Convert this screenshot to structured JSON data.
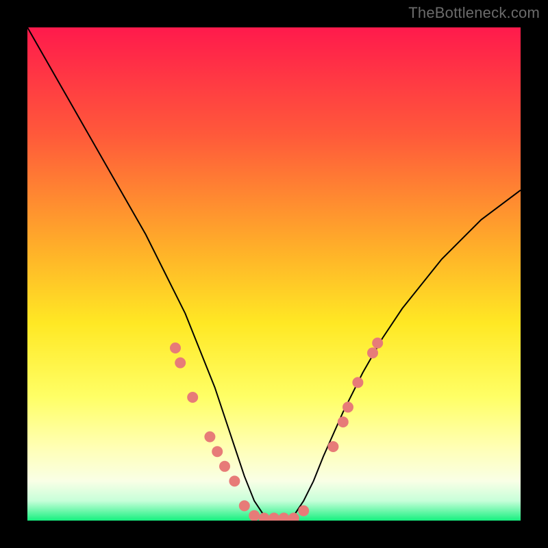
{
  "watermark": "TheBottleneck.com",
  "chart_data": {
    "type": "line",
    "title": "",
    "xlabel": "",
    "ylabel": "",
    "xlim": [
      0,
      100
    ],
    "ylim": [
      0,
      100
    ],
    "grid": false,
    "legend": false,
    "gradient_stops": [
      {
        "offset": 0,
        "color": "#ff1a4c"
      },
      {
        "offset": 22,
        "color": "#ff5a3a"
      },
      {
        "offset": 45,
        "color": "#ffb029"
      },
      {
        "offset": 60,
        "color": "#ffe824"
      },
      {
        "offset": 75,
        "color": "#ffff66"
      },
      {
        "offset": 85,
        "color": "#ffffb3"
      },
      {
        "offset": 92,
        "color": "#f9ffe6"
      },
      {
        "offset": 96,
        "color": "#c7ffd9"
      },
      {
        "offset": 100,
        "color": "#17f07f"
      }
    ],
    "series": [
      {
        "name": "curve",
        "x": [
          0,
          4,
          8,
          12,
          16,
          20,
          24,
          28,
          30,
          32,
          34,
          36,
          38,
          40,
          42,
          44,
          46,
          48,
          50,
          52,
          54,
          56,
          58,
          60,
          64,
          68,
          72,
          76,
          80,
          84,
          88,
          92,
          96,
          100
        ],
        "y": [
          100,
          93,
          86,
          79,
          72,
          65,
          58,
          50,
          46,
          42,
          37,
          32,
          27,
          21,
          15,
          9,
          4,
          1,
          0,
          0,
          1,
          4,
          8,
          13,
          22,
          30,
          37,
          43,
          48,
          53,
          57,
          61,
          64,
          67
        ]
      }
    ],
    "markers": [
      {
        "x": 30,
        "y": 35
      },
      {
        "x": 31,
        "y": 32
      },
      {
        "x": 33.5,
        "y": 25
      },
      {
        "x": 37,
        "y": 17
      },
      {
        "x": 38.5,
        "y": 14
      },
      {
        "x": 40,
        "y": 11
      },
      {
        "x": 42,
        "y": 8
      },
      {
        "x": 44,
        "y": 3
      },
      {
        "x": 46,
        "y": 1
      },
      {
        "x": 48,
        "y": 0.5
      },
      {
        "x": 50,
        "y": 0.5
      },
      {
        "x": 52,
        "y": 0.5
      },
      {
        "x": 54,
        "y": 0.5
      },
      {
        "x": 56,
        "y": 2
      },
      {
        "x": 62,
        "y": 15
      },
      {
        "x": 64,
        "y": 20
      },
      {
        "x": 65,
        "y": 23
      },
      {
        "x": 67,
        "y": 28
      },
      {
        "x": 70,
        "y": 34
      },
      {
        "x": 71,
        "y": 36
      }
    ],
    "marker_style": {
      "r": 8,
      "fill": "#e77b78"
    },
    "curve_style": {
      "stroke": "#000000",
      "width": 2
    }
  }
}
